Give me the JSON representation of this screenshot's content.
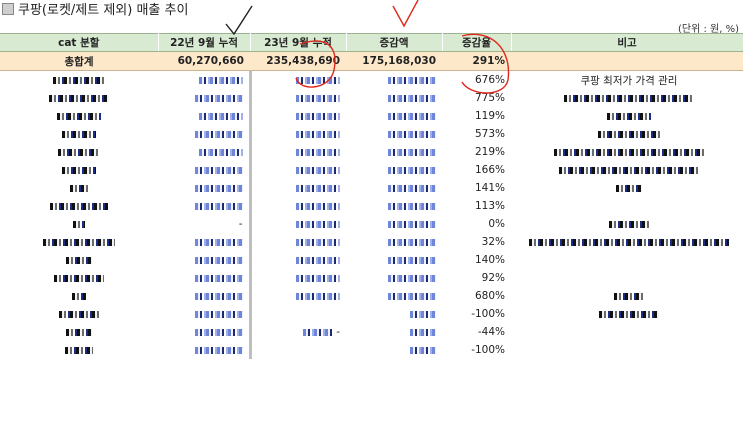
{
  "title": "쿠팡(로켓/제트 제외) 매출 추이",
  "unit": "(단위 : 원, %)",
  "headers": [
    "cat 분할",
    "22년 9월 누적",
    "23년 9월 누적",
    "증감액",
    "증감율",
    "비고"
  ],
  "total": {
    "label": "총합계",
    "prev": "60,270,660",
    "curr": "235,438,690",
    "diff": "175,168,030",
    "rate": "291%"
  },
  "rows": [
    {
      "rate": "676%",
      "note": "쿠팡 최저가 가격 관리"
    },
    {
      "rate": "775%",
      "note": ""
    },
    {
      "rate": "119%",
      "note": ""
    },
    {
      "rate": "573%",
      "note": ""
    },
    {
      "rate": "219%",
      "note": ""
    },
    {
      "rate": "166%",
      "note": ""
    },
    {
      "rate": "141%",
      "note": ""
    },
    {
      "rate": "113%",
      "note": ""
    },
    {
      "rate": "0%",
      "note": ""
    },
    {
      "rate": "32%",
      "note": ""
    },
    {
      "rate": "140%",
      "note": ""
    },
    {
      "rate": "92%",
      "note": ""
    },
    {
      "rate": "680%",
      "note": ""
    },
    {
      "rate": "-100%",
      "note": ""
    },
    {
      "rate": "-44%",
      "note": ""
    },
    {
      "rate": "-100%",
      "note": ""
    }
  ],
  "row5_prev_dash": "-",
  "row15_curr_dash": "-",
  "colors": {
    "header_bg": "#d9ead3",
    "total_bg": "#fde9c9",
    "annotation": "#e0271c"
  }
}
